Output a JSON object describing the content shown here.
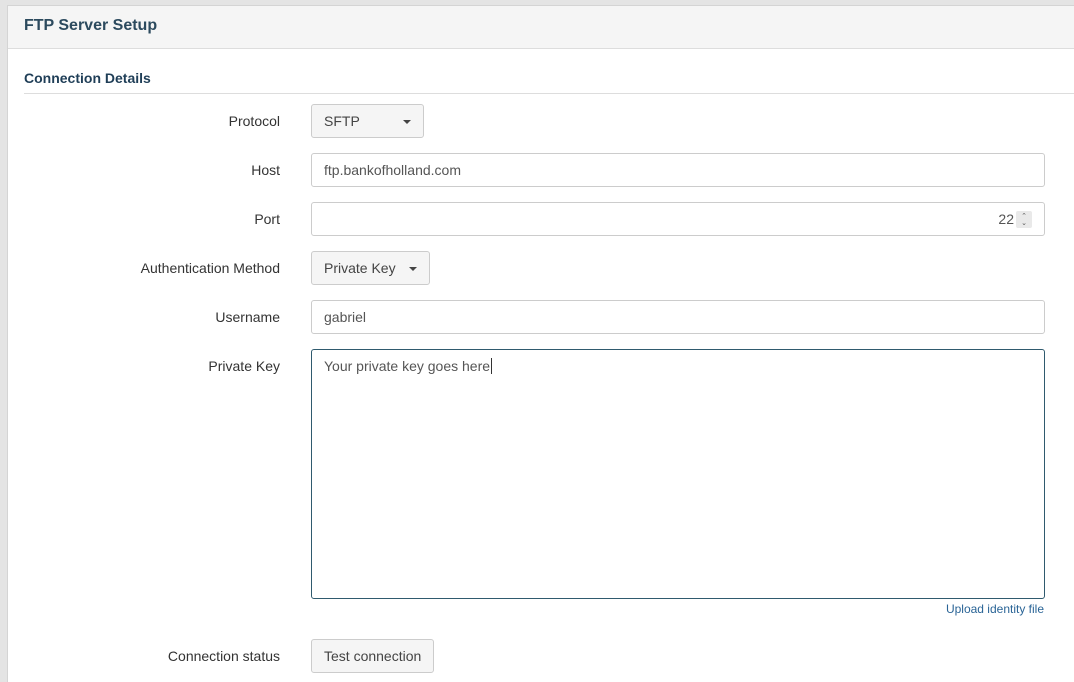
{
  "header": {
    "title": "FTP Server Setup"
  },
  "section": {
    "title": "Connection Details"
  },
  "fields": {
    "protocol": {
      "label": "Protocol",
      "value": "SFTP"
    },
    "host": {
      "label": "Host",
      "value": "ftp.bankofholland.com"
    },
    "port": {
      "label": "Port",
      "value": "22"
    },
    "auth_method": {
      "label": "Authentication Method",
      "value": "Private Key"
    },
    "username": {
      "label": "Username",
      "value": "gabriel"
    },
    "private_key": {
      "label": "Private Key",
      "value": "Your private key goes here"
    },
    "connection_status": {
      "label": "Connection status"
    }
  },
  "actions": {
    "upload_identity": "Upload identity file",
    "test_connection": "Test connection"
  },
  "icons": {
    "dropdown": "caret-down-icon",
    "spinner": "spinner-updown-icon"
  },
  "colors": {
    "title": "#2c4a5e",
    "link": "#2a6496",
    "focus_border": "#2f5a6e"
  }
}
